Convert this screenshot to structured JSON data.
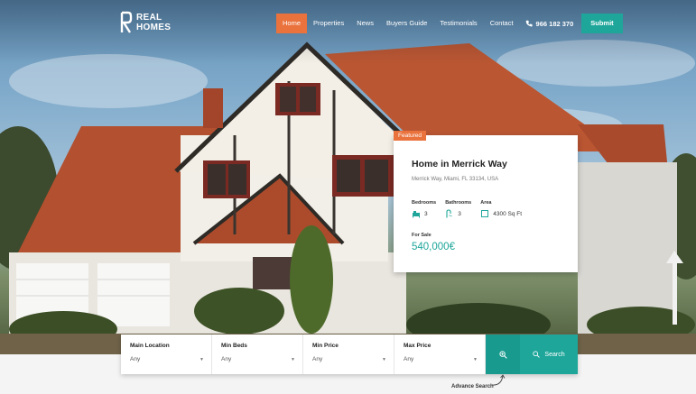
{
  "brand": {
    "logo_line1": "REAL",
    "logo_line2": "HOMES"
  },
  "nav": {
    "items": [
      {
        "label": "Home",
        "active": true
      },
      {
        "label": "Properties",
        "active": false
      },
      {
        "label": "News",
        "active": false
      },
      {
        "label": "Buyers Guide",
        "active": false
      },
      {
        "label": "Testimonials",
        "active": false
      },
      {
        "label": "Contact",
        "active": false
      }
    ],
    "phone": "966 182 370",
    "submit_label": "Submit"
  },
  "featured": {
    "badge": "Featured",
    "title": "Home in Merrick Way",
    "address": "Merrick Way, Miami, FL 33134, USA",
    "features": [
      {
        "label": "Bedrooms",
        "value": "3",
        "icon": "bed-icon"
      },
      {
        "label": "Bathrooms",
        "value": "3",
        "icon": "shower-icon"
      },
      {
        "label": "Area",
        "value": "4300 Sq Ft",
        "icon": "area-icon"
      }
    ],
    "status": "For Sale",
    "price": "540,000€"
  },
  "search": {
    "fields": [
      {
        "label": "Main Location",
        "value": "Any"
      },
      {
        "label": "Min Beds",
        "value": "Any"
      },
      {
        "label": "Min Price",
        "value": "Any"
      },
      {
        "label": "Max Price",
        "value": "Any"
      }
    ],
    "search_label": "Search",
    "advance_label": "Advance Search"
  },
  "colors": {
    "accent": "#ea723d",
    "primary": "#1ea69a",
    "primary_dark": "#189a8f"
  }
}
